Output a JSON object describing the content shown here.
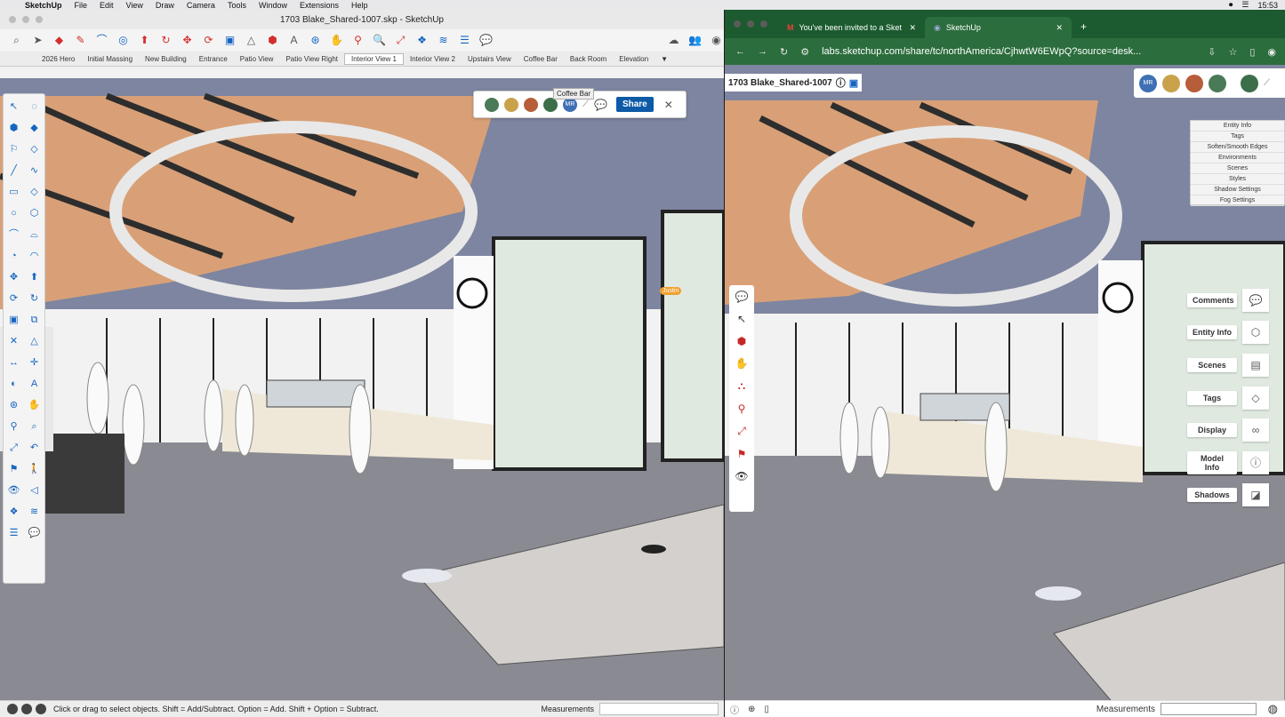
{
  "menubar": {
    "app": "SketchUp",
    "items": [
      "File",
      "Edit",
      "View",
      "Draw",
      "Camera",
      "Tools",
      "Window",
      "Extensions",
      "Help"
    ],
    "time": "15:53"
  },
  "sketchup": {
    "title": "1703 Blake_Shared-1007.skp - SketchUp",
    "tabs": [
      "2026 Hero",
      "Initial Massing",
      "New Building",
      "Entrance",
      "Patio View",
      "Patio View Right",
      "Interior View 1",
      "Interior View 2",
      "Upstairs View",
      "Coffee Bar",
      "Back Room",
      "Elevation"
    ],
    "active_tab": "Interior View 1",
    "tooltip": "Coffee Bar",
    "share_label": "Share",
    "collab_initials": "MR",
    "cursor_user": "Justin",
    "status_text": "Click or drag to select objects. Shift = Add/Subtract. Option = Add. Shift + Option = Subtract.",
    "measurements_label": "Measurements"
  },
  "browser": {
    "tabs": [
      {
        "label": "You've been invited to a Sket",
        "icon": "gmail-icon"
      },
      {
        "label": "SketchUp",
        "icon": "sketchup-icon"
      }
    ],
    "url": "labs.sketchup.com/share/tc/northAmerica/CjhwtW6EWpQ?source=desk...",
    "model_title": "1703 Blake_Shared-1007",
    "initials": "MR",
    "panels": [
      "Entity Info",
      "Tags",
      "Soften/Smooth Edges",
      "Environments",
      "Scenes",
      "Styles",
      "Shadow Settings",
      "Fog Settings"
    ],
    "right_tools": [
      "Comments",
      "Entity Info",
      "Scenes",
      "Tags",
      "Display",
      "Model Info",
      "Shadows"
    ],
    "measurements_label": "Measurements"
  },
  "colors": {
    "browser_green": "#1b5b2f",
    "share_blue": "#0d5aa7",
    "wall": "#f5f5f5",
    "floor": "#8a8a93",
    "ceiling": "#7e85a0",
    "wood": "#d9a077"
  }
}
